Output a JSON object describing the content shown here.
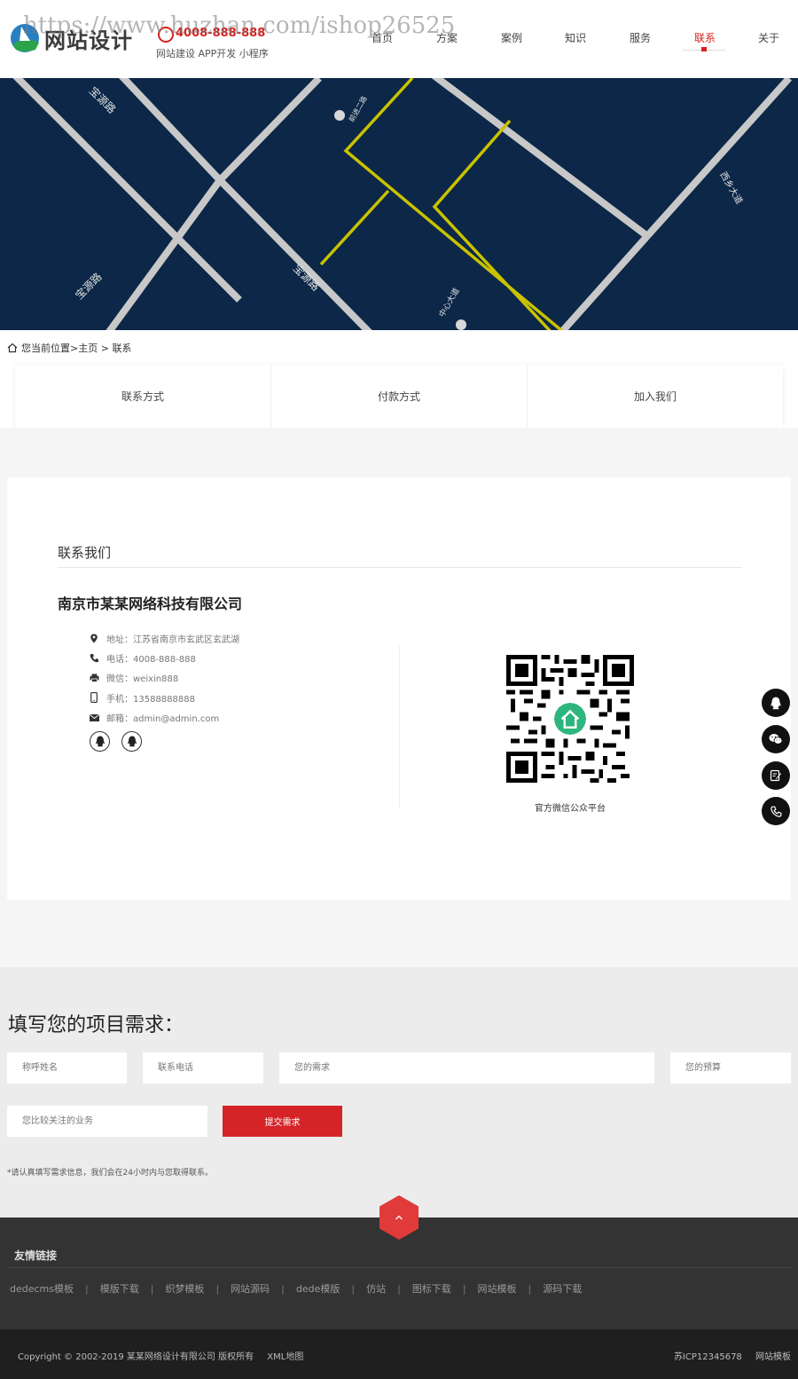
{
  "header": {
    "logo_text": "网站设计",
    "watermark": "https://www.huzhan.com/ishop26525",
    "phone": "4008-888-888",
    "slogan": "网站建设 APP开发 小程序",
    "nav": [
      {
        "label": "首页"
      },
      {
        "label": "方案"
      },
      {
        "label": "案例"
      },
      {
        "label": "知识"
      },
      {
        "label": "服务"
      },
      {
        "label": "联系",
        "active": true
      },
      {
        "label": "关于"
      }
    ]
  },
  "banner": {
    "map_labels": [
      "宝源路",
      "宝源路",
      "宝源路",
      "西乡大道",
      "中心大道",
      "前进二路"
    ]
  },
  "breadcrumb": {
    "prefix": "您当前位置>",
    "home": "主页",
    "sep": " > ",
    "current": "联系"
  },
  "tabs": [
    "联系方式",
    "付款方式",
    "加入我们"
  ],
  "contact": {
    "section_title": "联系我们",
    "company": "南京市某某网络科技有限公司",
    "address": "地址：江苏省南京市玄武区玄武湖",
    "tel": "电话：4008-888-888",
    "wechat": "微信：weixin888",
    "mobile": "手机：13588888888",
    "email": "邮箱：admin@admin.com",
    "qr_caption": "官方微信公众平台"
  },
  "form": {
    "title": "填写您的项目需求：",
    "name_placeholder": "称呼姓名",
    "phone_placeholder": "联系电话",
    "demand_placeholder": "您的需求",
    "budget_placeholder": "您的预算",
    "business_placeholder": "您比较关注的业务",
    "submit": "提交需求",
    "note": "*请认真填写需求信息，我们会在24小时内与您取得联系。"
  },
  "footer": {
    "links_title": "友情链接",
    "links": [
      "dedecms模板",
      "模版下载",
      "织梦模板",
      "网站源码",
      "dede模版",
      "仿站",
      "图标下载",
      "网站模板",
      "源码下载"
    ],
    "copyright": "Copyright © 2002-2019 某某网络设计有限公司 版权所有",
    "sitemap": "XML地图",
    "icp": "苏ICP12345678",
    "site_template": "网站模板"
  },
  "colors": {
    "accent": "#d72222",
    "banner_bg": "#0c2747",
    "road": "#c8c8c8",
    "metro": "#c9c200"
  }
}
